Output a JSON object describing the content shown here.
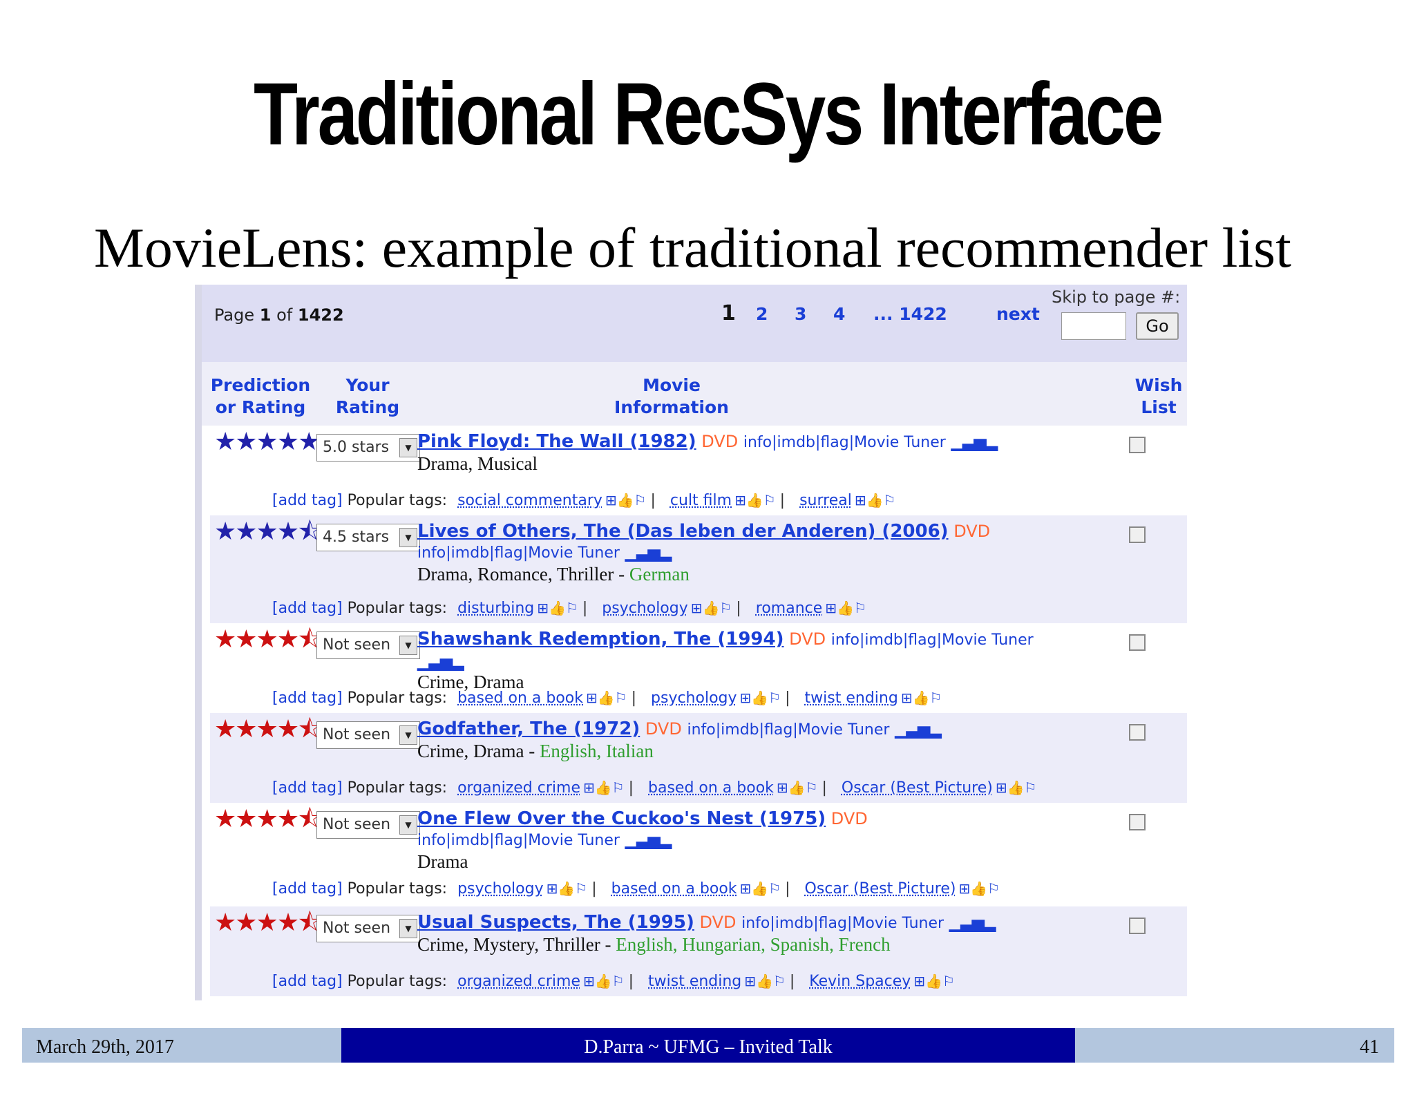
{
  "slide": {
    "title": "Traditional RecSys Interface",
    "subtitle": "MovieLens: example of traditional recommender list"
  },
  "pager": {
    "page_prefix": "Page",
    "page_current": "1",
    "page_of": "of",
    "page_total": "1422",
    "pages": [
      "1",
      "2",
      "3",
      "4",
      "... 1422"
    ],
    "next": "next",
    "skip_label": "Skip to page #:",
    "skip_value": "",
    "go": "Go"
  },
  "columns": {
    "prediction": "Prediction or Rating",
    "your_rating": "Your Rating",
    "movie_info": "Movie Information",
    "wish_list": "Wish List"
  },
  "common": {
    "add_tag": "[add tag]",
    "popular_tags": "Popular tags:",
    "dvd": "DVD",
    "links": "info|imdb|flag|Movie Tuner"
  },
  "movies": [
    {
      "stars": "★★★★★",
      "star_color": "blue",
      "rating": "5.0 stars",
      "title": "Pink Floyd: The Wall (1982)",
      "genres": "Drama, Musical",
      "languages": "",
      "tags": [
        "social commentary",
        "cult film",
        "surreal"
      ]
    },
    {
      "stars": "★★★★⯪",
      "star_color": "blue",
      "rating": "4.5 stars",
      "title": "Lives of Others, The (Das leben der Anderen) (2006)",
      "genres": "Drama, Romance, Thriller - ",
      "languages": "German",
      "tags": [
        "disturbing",
        "psychology",
        "romance"
      ]
    },
    {
      "stars": "★★★★⯪",
      "star_color": "red",
      "rating": "Not seen",
      "title": "Shawshank Redemption, The (1994)",
      "genres": "Crime, Drama",
      "languages": "",
      "tags": [
        "based on a book",
        "psychology",
        "twist ending"
      ]
    },
    {
      "stars": "★★★★⯪",
      "star_color": "red",
      "rating": "Not seen",
      "title": "Godfather, The (1972)",
      "genres": "Crime, Drama - ",
      "languages": "English, Italian",
      "tags": [
        "organized crime",
        "based on a book",
        "Oscar (Best Picture)"
      ]
    },
    {
      "stars": "★★★★⯪",
      "star_color": "red",
      "rating": "Not seen",
      "title": "One Flew Over the Cuckoo's Nest (1975)",
      "genres": "Drama",
      "languages": "",
      "tags": [
        "psychology",
        "based on a book",
        "Oscar (Best Picture)"
      ]
    },
    {
      "stars": "★★★★⯪",
      "star_color": "red",
      "rating": "Not seen",
      "title": "Usual Suspects, The (1995)",
      "genres": "Crime, Mystery, Thriller - ",
      "languages": "English, Hungarian, Spanish, French",
      "tags": [
        "organized crime",
        "twist ending",
        "Kevin Spacey"
      ]
    }
  ],
  "footer": {
    "date": "March 29th, 2017",
    "talk": "D.Parra ~ UFMG – Invited Talk",
    "page": "41"
  },
  "colors": {
    "link_blue": "#1a3fd6",
    "dvd_orange": "#ff6633",
    "language_green": "#2f9e2f",
    "footer_navy": "#000099",
    "footer_light": "#b3c6de"
  }
}
